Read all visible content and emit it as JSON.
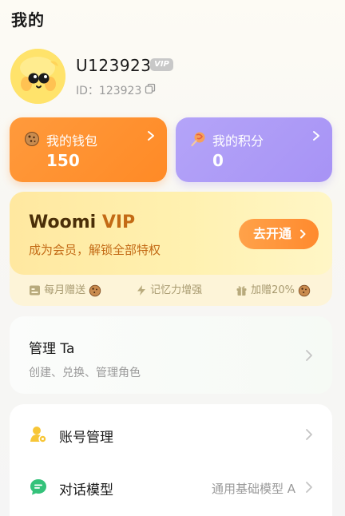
{
  "header": {
    "title": "我的"
  },
  "profile": {
    "username": "U123923",
    "vip_badge": "VIP",
    "user_id": "ID：123923"
  },
  "wallet": {
    "label": "我的钱包",
    "value": "150",
    "icon": "cookie-icon"
  },
  "points": {
    "label": "我的积分",
    "value": "0",
    "icon": "lollipop-icon"
  },
  "vip": {
    "title_prefix": "Woomi ",
    "title_accent": "VIP",
    "subtitle": "成为会员，解锁全部特权",
    "button_label": "去开通",
    "perks": [
      "每月赠送",
      "记忆力增强",
      "加赠20%"
    ]
  },
  "manage": {
    "title": "管理 Ta",
    "subtitle": "创建、兑换、管理角色"
  },
  "settings": {
    "items": [
      {
        "label": "账号管理",
        "value": "",
        "icon": "account-manage-icon"
      },
      {
        "label": "对话模型",
        "value": "通用基础模型 A",
        "icon": "chat-model-icon"
      }
    ]
  },
  "colors": {
    "wallet_bg": "#ff8f30",
    "points_bg": "#ad9bf6",
    "vip_button": "#ff9640",
    "vip_accent": "#c36a15"
  }
}
